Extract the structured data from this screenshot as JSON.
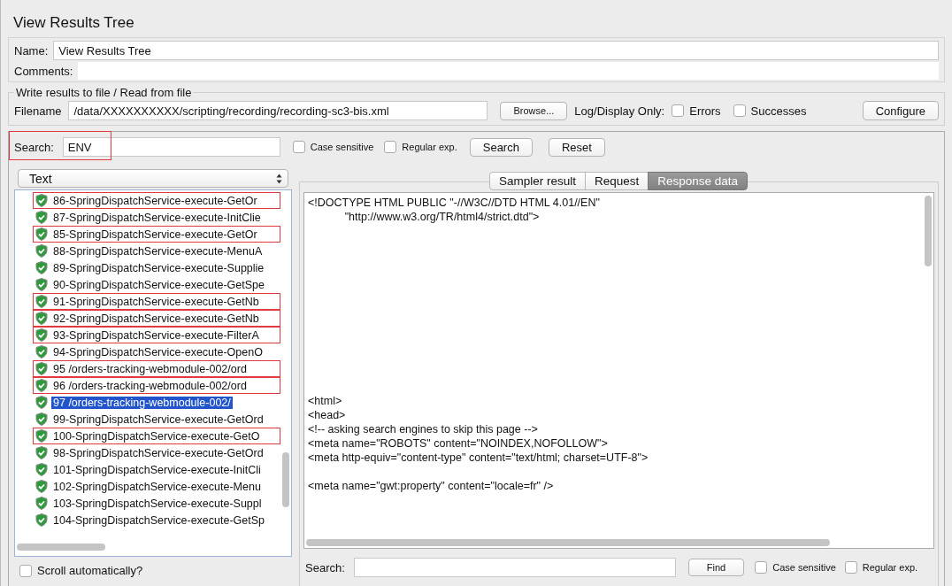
{
  "title": "View Results Tree",
  "name_field": {
    "label": "Name:",
    "value": "View Results Tree"
  },
  "comments_field": {
    "label": "Comments:"
  },
  "file_group": {
    "legend": "Write results to file / Read from file",
    "filename_label": "Filename",
    "filename": "/data/XXXXXXXXXX/scripting/recording/recording-sc3-bis.xml",
    "browse_button": "Browse...",
    "log_label": "Log/Display Only:",
    "options": [
      {
        "label": "Errors",
        "checked": false
      },
      {
        "label": "Successes",
        "checked": false
      }
    ],
    "configure_button": "Configure"
  },
  "search": {
    "label": "Search:",
    "value": "ENV",
    "highlighted": true,
    "options": [
      {
        "label": "Case sensitive",
        "checked": false
      },
      {
        "label": "Regular exp.",
        "checked": false
      }
    ],
    "buttons": [
      "Search",
      "Reset"
    ]
  },
  "renderer_select": {
    "value": "Text"
  },
  "tree": [
    {
      "label": "86-SpringDispatchService-execute-GetOr",
      "match": true,
      "selected": false
    },
    {
      "label": "87-SpringDispatchService-execute-InitClie",
      "match": false,
      "selected": false
    },
    {
      "label": "85-SpringDispatchService-execute-GetOr",
      "match": true,
      "selected": false
    },
    {
      "label": "88-SpringDispatchService-execute-MenuA",
      "match": false,
      "selected": false
    },
    {
      "label": "89-SpringDispatchService-execute-Supplie",
      "match": false,
      "selected": false
    },
    {
      "label": "90-SpringDispatchService-execute-GetSpe",
      "match": false,
      "selected": false
    },
    {
      "label": "91-SpringDispatchService-execute-GetNb",
      "match": true,
      "selected": false
    },
    {
      "label": "92-SpringDispatchService-execute-GetNb",
      "match": true,
      "selected": false
    },
    {
      "label": "93-SpringDispatchService-execute-FilterA",
      "match": true,
      "selected": false
    },
    {
      "label": "94-SpringDispatchService-execute-OpenO",
      "match": false,
      "selected": false
    },
    {
      "label": "95 /orders-tracking-webmodule-002/ord",
      "match": true,
      "selected": false
    },
    {
      "label": "96 /orders-tracking-webmodule-002/ord",
      "match": true,
      "selected": false
    },
    {
      "label": "97 /orders-tracking-webmodule-002/",
      "match": false,
      "selected": true
    },
    {
      "label": "99-SpringDispatchService-execute-GetOrd",
      "match": false,
      "selected": false
    },
    {
      "label": "100-SpringDispatchService-execute-GetO",
      "match": true,
      "selected": false
    },
    {
      "label": "98-SpringDispatchService-execute-GetOrd",
      "match": false,
      "selected": false
    },
    {
      "label": "101-SpringDispatchService-execute-InitCli",
      "match": false,
      "selected": false
    },
    {
      "label": "102-SpringDispatchService-execute-Menu",
      "match": false,
      "selected": false
    },
    {
      "label": "103-SpringDispatchService-execute-Suppl",
      "match": false,
      "selected": false
    },
    {
      "label": "104-SpringDispatchService-execute-GetSp",
      "match": false,
      "selected": false
    }
  ],
  "scroll_auto": {
    "label": "Scroll automatically?",
    "checked": false
  },
  "tabs": [
    {
      "label": "Sampler result",
      "selected": false
    },
    {
      "label": "Request",
      "selected": false
    },
    {
      "label": "Response data",
      "selected": true
    }
  ],
  "response_text": "<!DOCTYPE HTML PUBLIC \"-//W3C//DTD HTML 4.01//EN\"\n            \"http://www.w3.org/TR/html4/strict.dtd\">\n\n\n\n\n\n\n\n\n\n\n\n\n<html>\n<head>\n<!-- asking search engines to skip this page -->\n<meta name=\"ROBOTS\" content=\"NOINDEX,NOFOLLOW\">\n<meta http-equiv=\"content-type\" content=\"text/html; charset=UTF-8\">\n\n<meta name=\"gwt:property\" content=\"locale=fr\" />",
  "find_bar": {
    "label": "Search:",
    "button": "Find",
    "options": [
      {
        "label": "Case sensitive",
        "checked": false
      },
      {
        "label": "Regular exp.",
        "checked": false
      }
    ]
  }
}
